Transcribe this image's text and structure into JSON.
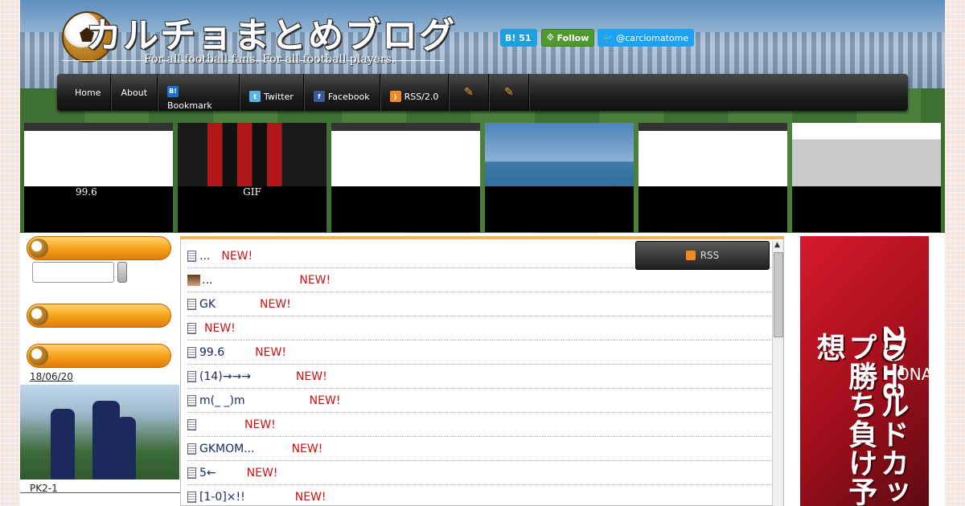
{
  "header": {
    "title": "カルチョまとめブログ",
    "subtitle": "For all football fans.  For all football players.",
    "hatebu_count": "51",
    "follow_label": "Follow",
    "twitter_handle": "@carciomatome"
  },
  "nav": {
    "items": [
      {
        "label": "Home"
      },
      {
        "label": "About"
      },
      {
        "label": "Bookmark"
      },
      {
        "label": "Twitter"
      },
      {
        "label": "Facebook"
      },
      {
        "label": "RSS/2.0"
      }
    ]
  },
  "thumbs": [
    {
      "caption": "99.6"
    },
    {
      "caption": "GIF"
    },
    {
      "caption": ""
    },
    {
      "caption": ""
    },
    {
      "caption": ""
    },
    {
      "caption": ""
    }
  ],
  "sidebar": {
    "date": "18/06/20",
    "photo_caption": "PK2-1"
  },
  "list": {
    "new_label": "NEW!",
    "rows": [
      {
        "title": "..."
      },
      {
        "title": "..."
      },
      {
        "title": "GK"
      },
      {
        "title": ""
      },
      {
        "title": "99.6"
      },
      {
        "title": "(14)→→→"
      },
      {
        "title": "m(_ _)m"
      },
      {
        "title": ""
      },
      {
        "title": "GKMOM..."
      },
      {
        "title": "5←"
      },
      {
        "title": "[1-0]×!!"
      }
    ]
  },
  "rss_button": "RSS",
  "banner": {
    "year": "2018",
    "text": "ワールドカップ勝ち負け予想",
    "shirt": "ONAL"
  }
}
